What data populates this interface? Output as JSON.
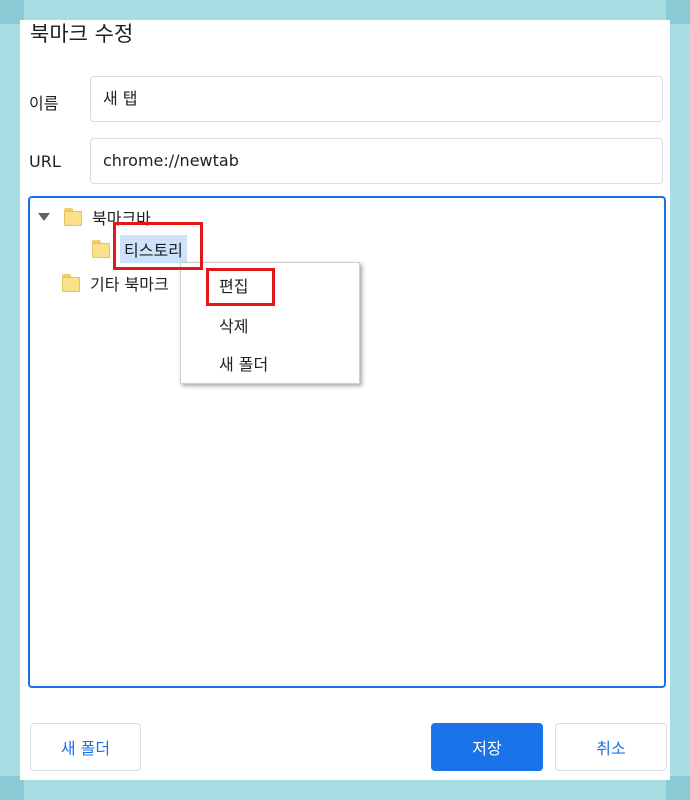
{
  "dialog": {
    "title": "북마크 수정"
  },
  "form": {
    "name_label": "이름",
    "name_value": "새 탭",
    "url_label": "URL",
    "url_value": "chrome://newtab"
  },
  "tree": {
    "root_label": "북마크바",
    "child_label": "티스토리",
    "other_label": "기타 북마크"
  },
  "context_menu": {
    "items": [
      "편집",
      "삭제",
      "새 폴더"
    ]
  },
  "buttons": {
    "new_folder": "새 폴더",
    "save": "저장",
    "cancel": "취소"
  },
  "colors": {
    "accent": "#1a73e8",
    "highlight_box": "#e01818",
    "selection": "#cde2fb",
    "frame": "#a9dde4"
  }
}
